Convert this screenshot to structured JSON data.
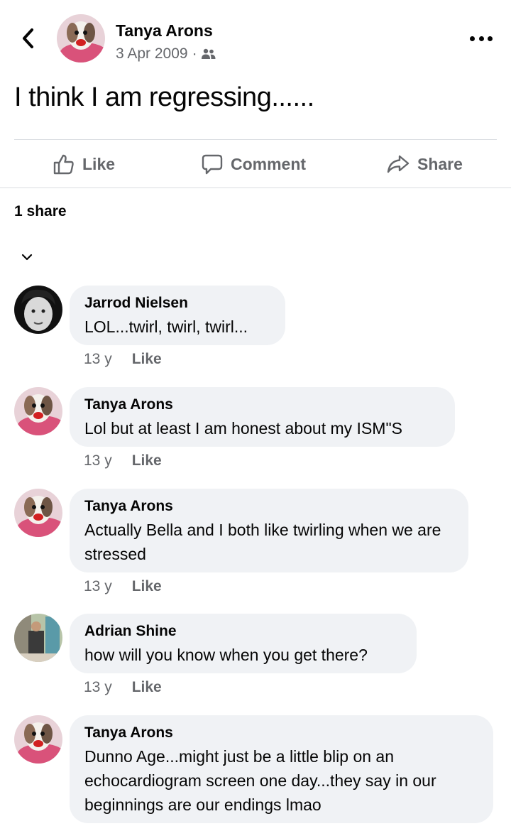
{
  "post": {
    "author": "Tanya Arons",
    "date": "3 Apr 2009",
    "separator": "·",
    "audience_icon": "friends-icon",
    "text": "I think I am regressing......"
  },
  "actions": {
    "like_label": "Like",
    "comment_label": "Comment",
    "share_label": "Share"
  },
  "shares": "1 share",
  "comments": [
    {
      "name": "Jarrod Nielsen",
      "text": "LOL...twirl, twirl, twirl...",
      "time": "13 y",
      "like_label": "Like"
    },
    {
      "name": "Tanya Arons",
      "text": "Lol but at least I am honest about my ISM\"S",
      "time": "13 y",
      "like_label": "Like"
    },
    {
      "name": "Tanya Arons",
      "text": "Actually Bella and I both like twirling when we are stressed",
      "time": "13 y",
      "like_label": "Like"
    },
    {
      "name": "Adrian Shine",
      "text": "how will you know when you get there?",
      "time": "13 y",
      "like_label": "Like"
    },
    {
      "name": "Tanya Arons",
      "text": "Dunno Age...might just be a little blip on an echocardiogram screen one day...they say in our beginnings are our endings lmao",
      "time": "",
      "like_label": ""
    }
  ],
  "colors": {
    "bubble": "#f0f2f5",
    "secondary_text": "#65676b",
    "primary_text": "#050505",
    "divider": "#dadde1"
  }
}
